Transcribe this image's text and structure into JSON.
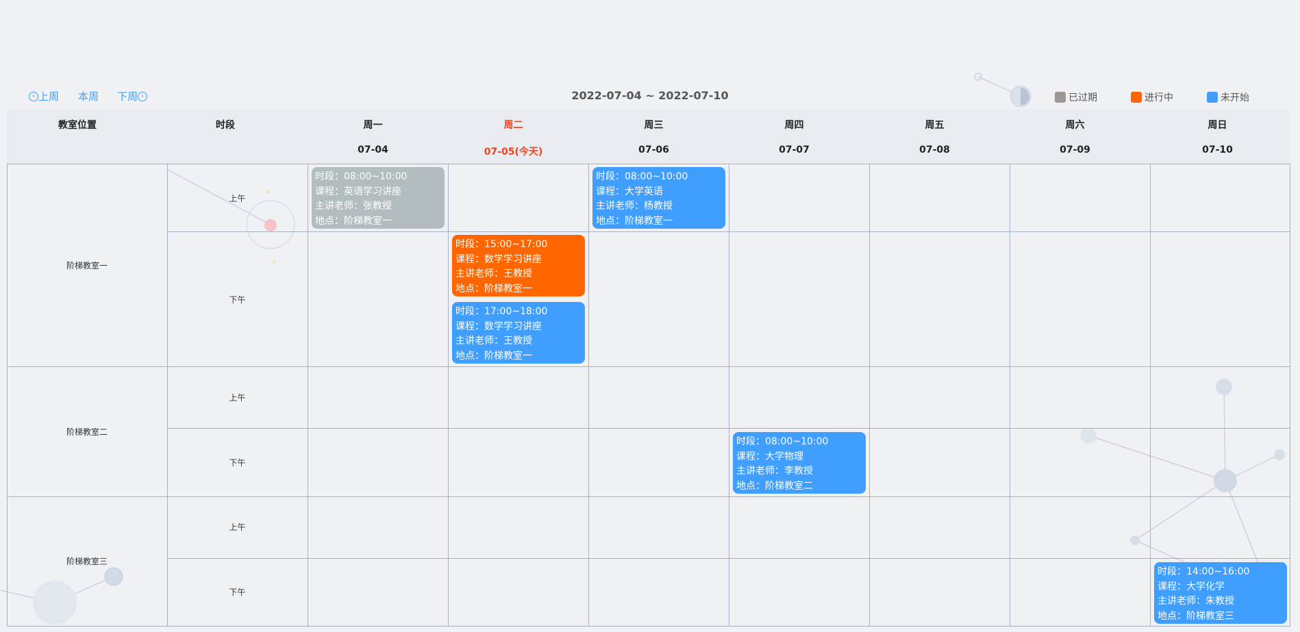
{
  "nav": {
    "prev": "上周",
    "current": "本周",
    "next": "下周"
  },
  "week_range": "2022-07-04 ~ 2022-07-10",
  "legend": [
    {
      "label": "已过期",
      "color": "#9e9794"
    },
    {
      "label": "进行中",
      "color": "#ff6600"
    },
    {
      "label": "未开始",
      "color": "#409eff"
    }
  ],
  "header": {
    "room_label": "教室位置",
    "period_label": "时段",
    "days": [
      {
        "name": "周一",
        "date": "07-04"
      },
      {
        "name": "周二",
        "date": "07-05(今天)"
      },
      {
        "name": "周三",
        "date": "07-06"
      },
      {
        "name": "周四",
        "date": "07-07"
      },
      {
        "name": "周五",
        "date": "07-08"
      },
      {
        "name": "周六",
        "date": "07-09"
      },
      {
        "name": "周日",
        "date": "07-10"
      }
    ]
  },
  "rooms": [
    {
      "name": "阶梯教室一",
      "periods": [
        "上午",
        "下午"
      ]
    },
    {
      "name": "阶梯教室二",
      "periods": [
        "上午",
        "下午"
      ]
    },
    {
      "name": "阶梯教室三",
      "periods": [
        "上午",
        "下午"
      ]
    }
  ],
  "events": [
    {
      "status": "已过期",
      "color": "#b3bcbf",
      "time": "时段：08:00~10:00",
      "course": "课程：英语学习讲座",
      "teacher": "主讲老师：张教授",
      "place": "地点：阶梯教室一"
    },
    {
      "status": "未开始",
      "color": "#409eff",
      "time": "时段：08:00~10:00",
      "course": "课程：大学英语",
      "teacher": "主讲老师：杨教授",
      "place": "地点：阶梯教室一"
    },
    {
      "status": "进行中",
      "color": "#ff6600",
      "time": "时段：15:00~17:00",
      "course": "课程：数学学习讲座",
      "teacher": "主讲老师：王教授",
      "place": "地点：阶梯教室一"
    },
    {
      "status": "未开始",
      "color": "#409eff",
      "time": "时段：17:00~18:00",
      "course": "课程：数学学习讲座",
      "teacher": "主讲老师：王教授",
      "place": "地点：阶梯教室一"
    },
    {
      "status": "未开始",
      "color": "#409eff",
      "time": "时段：08:00~10:00",
      "course": "课程：大学物理",
      "teacher": "主讲老师：李教授",
      "place": "地点：阶梯教室二"
    },
    {
      "status": "未开始",
      "color": "#409eff",
      "time": "时段：14:00~16:00",
      "course": "课程：大学化学",
      "teacher": "主讲老师：朱教授",
      "place": "地点：阶梯教室三"
    }
  ]
}
